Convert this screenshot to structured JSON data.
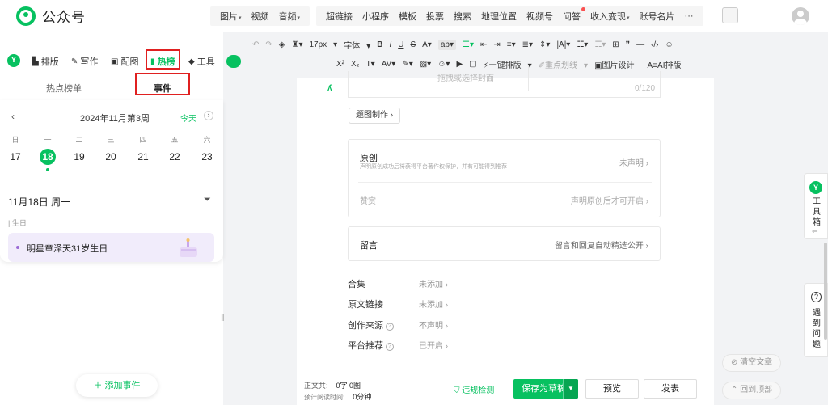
{
  "header": {
    "logo_text": "公众号",
    "menu_group1": [
      "图片",
      "视频",
      "音频"
    ],
    "menu_group2": [
      "超链接",
      "小程序",
      "模板",
      "投票",
      "搜索",
      "地理位置",
      "视频号",
      "问答",
      "收入变现",
      "账号名片",
      "···"
    ]
  },
  "left_toolbar": {
    "items": [
      "排版",
      "写作",
      "配图",
      "热榜",
      "工具"
    ],
    "highlighted": "热榜"
  },
  "format_toolbar": {
    "font_size": "17px",
    "font_label": "字体",
    "row2": {
      "one_click": "一键排版",
      "key_line": "重点划线",
      "image_design": "图片设计",
      "ai_layout": "AI排版"
    }
  },
  "left_panel": {
    "tabs": [
      "热点榜单",
      "事件"
    ],
    "active_tab": "事件",
    "calendar": {
      "title": "2024年11月第3周",
      "today_label": "今天",
      "weekdays": [
        "日",
        "一",
        "二",
        "三",
        "四",
        "五",
        "六"
      ],
      "days": [
        "17",
        "18",
        "19",
        "20",
        "21",
        "22",
        "23"
      ],
      "selected_day": "18"
    },
    "date_title": "11月18日 周一",
    "section_label": "| 生日",
    "event_text": "明星章泽天31岁生日",
    "add_event_label": "添加事件"
  },
  "editor": {
    "cover_hint": "拖拽或选择封面",
    "cover_count": "0/120",
    "tu_button": "题图制作",
    "original": {
      "title": "原创",
      "subtitle": "声明原创成功后将获得平台著作权保护，并有可能得到推荐",
      "right": "未声明",
      "zs_title": "赞赏",
      "zs_right": "声明原创后才可开启"
    },
    "comment": {
      "title": "留言",
      "right": "留言和回复自动精选公开"
    },
    "meta": [
      {
        "label": "合集",
        "value": "未添加",
        "help": false
      },
      {
        "label": "原文链接",
        "value": "未添加",
        "help": false
      },
      {
        "label": "创作来源",
        "value": "不声明",
        "help": true
      },
      {
        "label": "平台推荐",
        "value": "已开启",
        "help": true
      }
    ]
  },
  "footer": {
    "word_count_label": "正文共:",
    "word_count_value": "0字 0图",
    "read_time_label": "预计阅读时间:",
    "read_time_value": "0分钟",
    "check_label": "违规检测",
    "save_label": "保存为草稿",
    "preview_label": "预览",
    "publish_label": "发表"
  },
  "right_side": {
    "toolbox_text": "工具箱",
    "help_text": "遇到问题",
    "clear_label": "清空文章",
    "top_label": "回到顶部"
  },
  "colors": {
    "accent": "#07c160",
    "highlight_red": "#e02020",
    "event_bg": "#f1ecfb"
  }
}
